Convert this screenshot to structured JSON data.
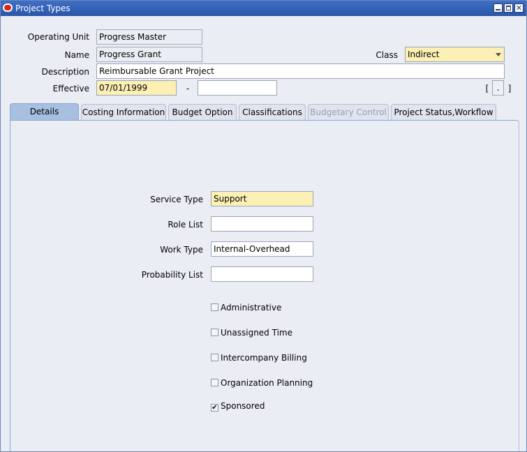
{
  "window": {
    "title": "Project Types",
    "close_glyph": "✕"
  },
  "form": {
    "operating_unit": {
      "label": "Operating Unit",
      "value": "Progress Master"
    },
    "name": {
      "label": "Name",
      "value": "Progress Grant"
    },
    "class": {
      "label": "Class",
      "value": "Indirect"
    },
    "description": {
      "label": "Description",
      "value": "Reimbursable Grant Project"
    },
    "effective": {
      "label": "Effective",
      "from": "07/01/1999",
      "separator": "-",
      "to": ""
    },
    "dff": {
      "open": "[",
      "value": ".",
      "close": "]"
    }
  },
  "tabs": [
    {
      "label": "Details",
      "state": "active"
    },
    {
      "label": "Costing Information",
      "state": "normal"
    },
    {
      "label": "Budget Option",
      "state": "normal"
    },
    {
      "label": "Classifications",
      "state": "normal"
    },
    {
      "label": "Budgetary Control",
      "state": "disabled"
    },
    {
      "label": "Project Status,Workflow",
      "state": "normal"
    }
  ],
  "details": {
    "service_type": {
      "label": "Service Type",
      "value": "Support"
    },
    "role_list": {
      "label": "Role List",
      "value": ""
    },
    "work_type": {
      "label": "Work Type",
      "value": "Internal-Overhead"
    },
    "probability_list": {
      "label": "Probability List",
      "value": ""
    },
    "checkboxes": [
      {
        "label": "Administrative",
        "checked": false
      },
      {
        "label": "Unassigned Time",
        "checked": false
      },
      {
        "label": "Intercompany Billing",
        "checked": false
      },
      {
        "label": "Organization Planning",
        "checked": false
      },
      {
        "label": "Sponsored",
        "checked": true
      }
    ],
    "check_glyph": "✔"
  },
  "colors": {
    "required_field": "#fcf0b4",
    "active_tab": "#a7bfe0",
    "titlebar": "#2a56a8",
    "window_bg": "#eaedf4"
  }
}
